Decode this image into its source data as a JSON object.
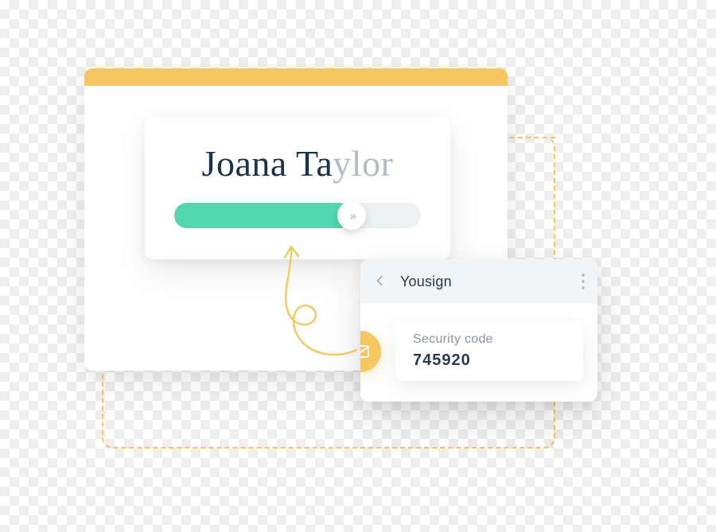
{
  "signature": {
    "first": "Joana Ta",
    "last_faded": "ylor"
  },
  "slider": {
    "thumb_glyph": "»"
  },
  "notification": {
    "app_name": "Yousign",
    "code_label": "Security code",
    "code_value": "745920"
  },
  "colors": {
    "accent_yellow": "#f6c661",
    "accent_teal": "#53d8ad",
    "text_dark": "#283a4f",
    "text_muted": "#8a94a0"
  }
}
